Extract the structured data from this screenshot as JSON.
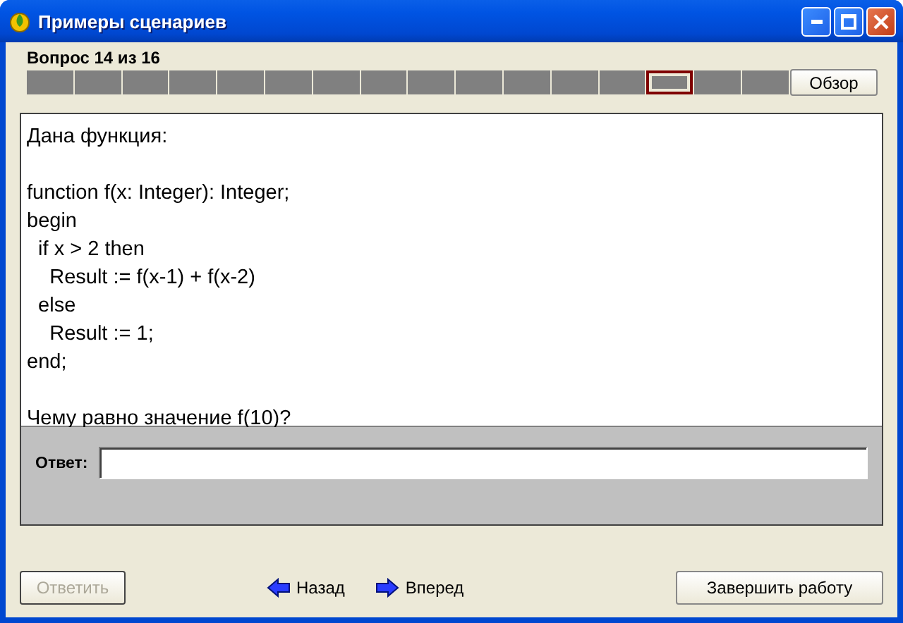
{
  "window": {
    "title": "Примеры сценариев"
  },
  "progress": {
    "label": "Вопрос 14 из 16",
    "cells": [
      {
        "selected": false
      },
      {
        "selected": false
      },
      {
        "selected": false
      },
      {
        "selected": false
      },
      {
        "selected": false
      },
      {
        "selected": false
      },
      {
        "selected": false
      },
      {
        "selected": false
      },
      {
        "selected": false
      },
      {
        "selected": false
      },
      {
        "selected": false
      },
      {
        "selected": false
      },
      {
        "selected": false
      },
      {
        "selected": true
      },
      {
        "selected": false
      },
      {
        "selected": false
      }
    ],
    "review_button": "Обзор"
  },
  "question": {
    "intro": "Дана функция:",
    "code": [
      "function f(x: Integer): Integer;",
      "begin",
      "  if x > 2 then",
      "    Result := f(x-1) + f(x-2)",
      "  else",
      "    Result := 1;",
      "end;"
    ],
    "prompt": "Чему равно значение f(10)?"
  },
  "answer": {
    "label": "Ответ:"
  },
  "buttons": {
    "submit": {
      "label": "Ответить",
      "disabled": true
    },
    "back": "Назад",
    "forward": "Вперед",
    "finish": "Завершить работу"
  }
}
